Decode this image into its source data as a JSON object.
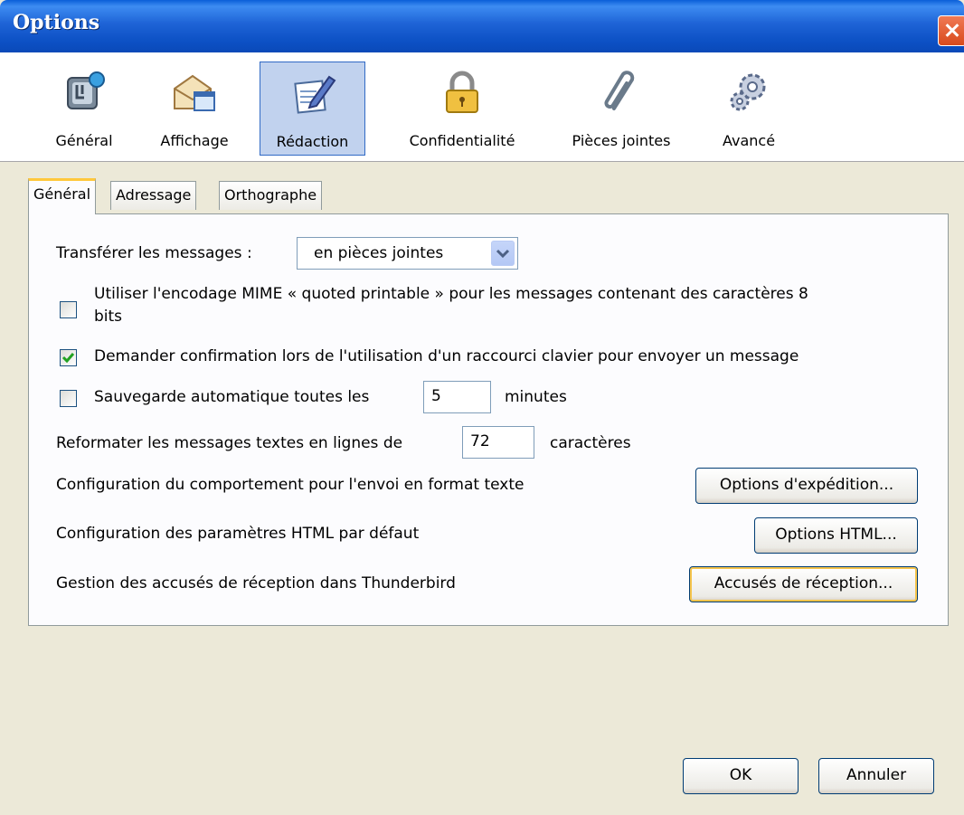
{
  "window": {
    "title": "Options"
  },
  "toolbar": {
    "panes": [
      {
        "label": "Général",
        "icon": "general-settings-icon"
      },
      {
        "label": "Affichage",
        "icon": "display-icon"
      },
      {
        "label": "Rédaction",
        "icon": "compose-pen-icon",
        "selected": true
      },
      {
        "label": "Confidentialité",
        "icon": "padlock-icon"
      },
      {
        "label": "Pièces jointes",
        "icon": "paperclip-icon"
      },
      {
        "label": "Avancé",
        "icon": "gears-icon"
      }
    ]
  },
  "tabs": [
    {
      "label": "Général",
      "active": true
    },
    {
      "label": "Adressage"
    },
    {
      "label": "Orthographe"
    }
  ],
  "general": {
    "forward_label": "Transférer les messages :",
    "forward_value": "en pièces jointes",
    "mime_label_line1": "Utiliser l'encodage MIME « quoted printable » pour les messages contenant des caractères 8",
    "mime_label_line2": "bits",
    "mime_checked": false,
    "confirm_label": "Demander confirmation lors de l'utilisation d'un raccourci clavier pour envoyer un message",
    "confirm_checked": true,
    "autosave_label": "Sauvegarde automatique toutes les",
    "autosave_value": "5",
    "autosave_unit": "minutes",
    "autosave_checked": false,
    "wrap_label": "Reformater les messages textes en lignes de",
    "wrap_value": "72",
    "wrap_unit": "caractères",
    "send_format_label": "Configuration du comportement pour l'envoi en format texte",
    "send_format_button": "Options d'expédition...",
    "html_label": "Configuration des paramètres HTML par défaut",
    "html_button": "Options HTML...",
    "receipts_label": "Gestion des accusés de réception dans Thunderbird",
    "receipts_button": "Accusés de réception..."
  },
  "footer": {
    "ok": "OK",
    "cancel": "Annuler"
  }
}
